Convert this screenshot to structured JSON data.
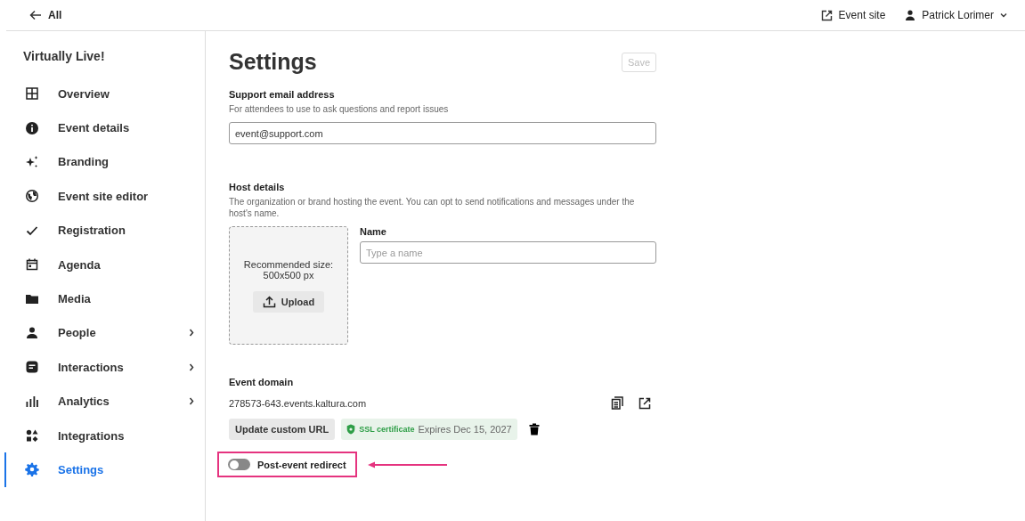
{
  "topbar": {
    "back": "All",
    "event_site": "Event site",
    "user": "Patrick Lorimer"
  },
  "sidebar": {
    "title": "Virtually Live!",
    "items": [
      {
        "label": "Overview",
        "kind": "grid",
        "chevron": false,
        "selected": false
      },
      {
        "label": "Event details",
        "kind": "info",
        "chevron": false,
        "selected": false
      },
      {
        "label": "Branding",
        "kind": "sparkle",
        "chevron": false,
        "selected": false
      },
      {
        "label": "Event site editor",
        "kind": "globe",
        "chevron": false,
        "selected": false
      },
      {
        "label": "Registration",
        "kind": "check",
        "chevron": false,
        "selected": false
      },
      {
        "label": "Agenda",
        "kind": "calendar",
        "chevron": false,
        "selected": false
      },
      {
        "label": "Media",
        "kind": "folder",
        "chevron": false,
        "selected": false
      },
      {
        "label": "People",
        "kind": "person",
        "chevron": true,
        "selected": false
      },
      {
        "label": "Interactions",
        "kind": "chat",
        "chevron": true,
        "selected": false
      },
      {
        "label": "Analytics",
        "kind": "bars",
        "chevron": true,
        "selected": false
      },
      {
        "label": "Integrations",
        "kind": "shapes",
        "chevron": false,
        "selected": false
      },
      {
        "label": "Settings",
        "kind": "gear",
        "chevron": false,
        "selected": true
      }
    ]
  },
  "page": {
    "title": "Settings",
    "save": {
      "label": "Save",
      "disabled": true
    },
    "support": {
      "label": "Support email address",
      "hint": "For attendees to use to ask questions and report issues",
      "value": "event@support.com"
    },
    "host": {
      "label": "Host details",
      "hint": "The organization or brand hosting the event. You can opt to send notifications and messages under the host's name.",
      "recommend": [
        "Recommended size:",
        "500x500 px"
      ],
      "upload": "Upload",
      "name_label": "Name",
      "name_placeholder": "Type a name"
    },
    "domain": {
      "label": "Event domain",
      "value": "278573-643.events.kaltura.com",
      "update": "Update custom URL",
      "ssl": "SSL certificate",
      "expires": "Expires Dec 15, 2027"
    },
    "redirect": {
      "label": "Post-event redirect",
      "on": false
    }
  }
}
